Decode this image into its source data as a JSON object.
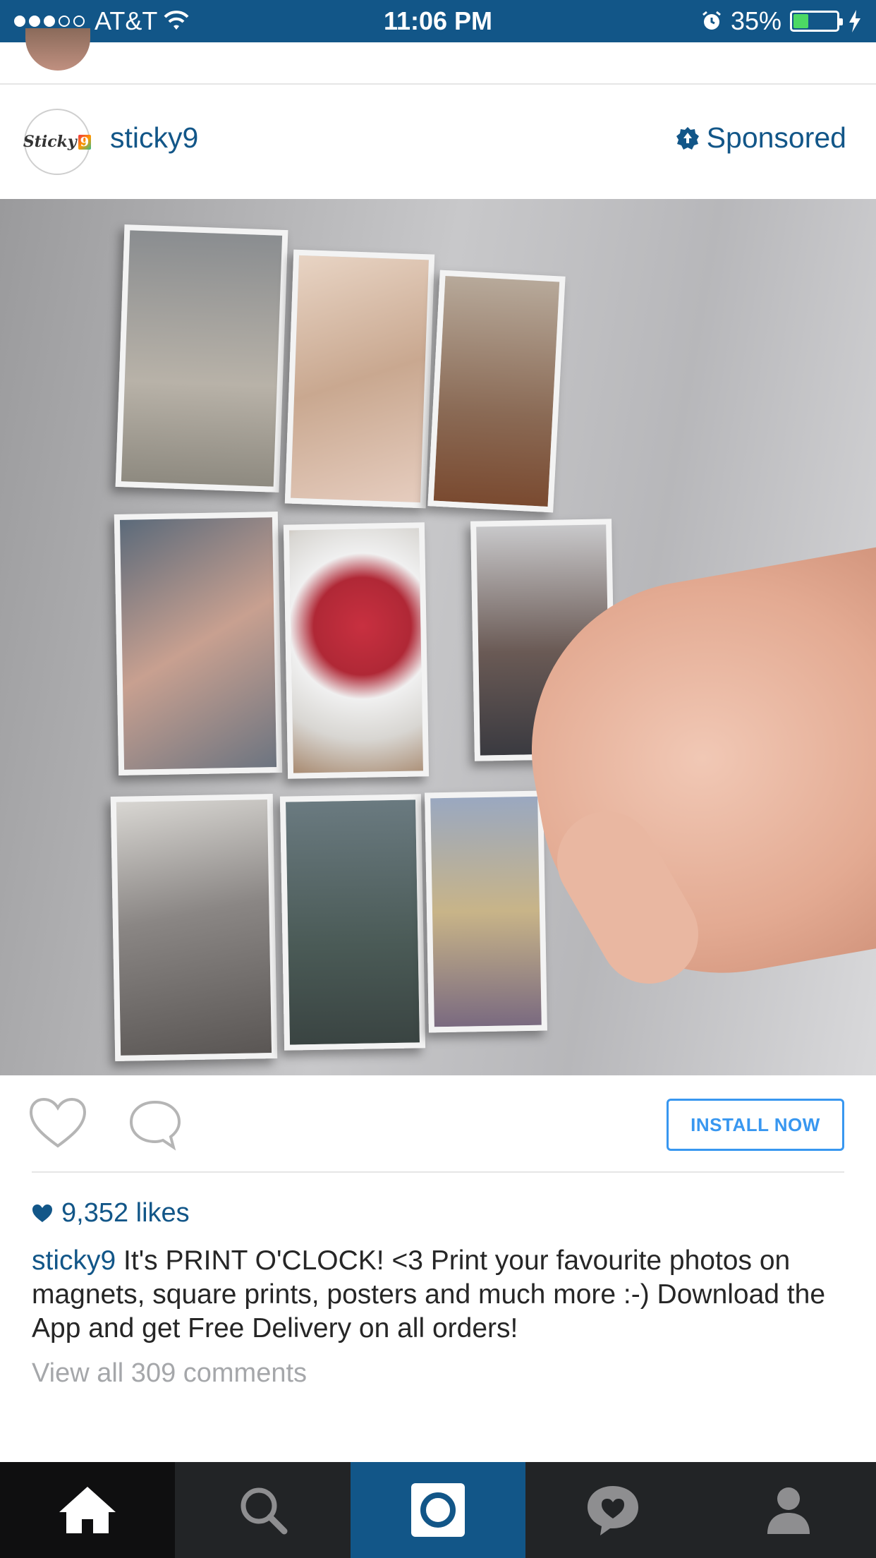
{
  "status_bar": {
    "carrier": "AT&T",
    "time": "11:06 PM",
    "battery_percent": "35%",
    "battery_level": 0.35,
    "signal_bars_filled": 3,
    "signal_bars_total": 5
  },
  "post": {
    "username": "sticky9",
    "avatar_text": "Sticky",
    "avatar_badge": "9",
    "sponsored_label": "Sponsored",
    "likes": "9,352 likes",
    "caption_user": "sticky9",
    "caption_text": "It's PRINT O'CLOCK! <3 Print your favourite photos on magnets, square prints, posters and much more :-) Download the App and get Free Delivery on all orders!",
    "view_comments": "View all 309 comments",
    "install_label": "INSTALL NOW"
  },
  "tabs": [
    {
      "name": "home",
      "icon": "home-icon"
    },
    {
      "name": "search",
      "icon": "search-icon"
    },
    {
      "name": "camera",
      "icon": "camera-icon"
    },
    {
      "name": "activity",
      "icon": "heart-bubble-icon"
    },
    {
      "name": "profile",
      "icon": "profile-icon"
    }
  ],
  "colors": {
    "brand_blue": "#125688",
    "accent_blue": "#3897f0",
    "tab_bar_bg": "#222426"
  }
}
